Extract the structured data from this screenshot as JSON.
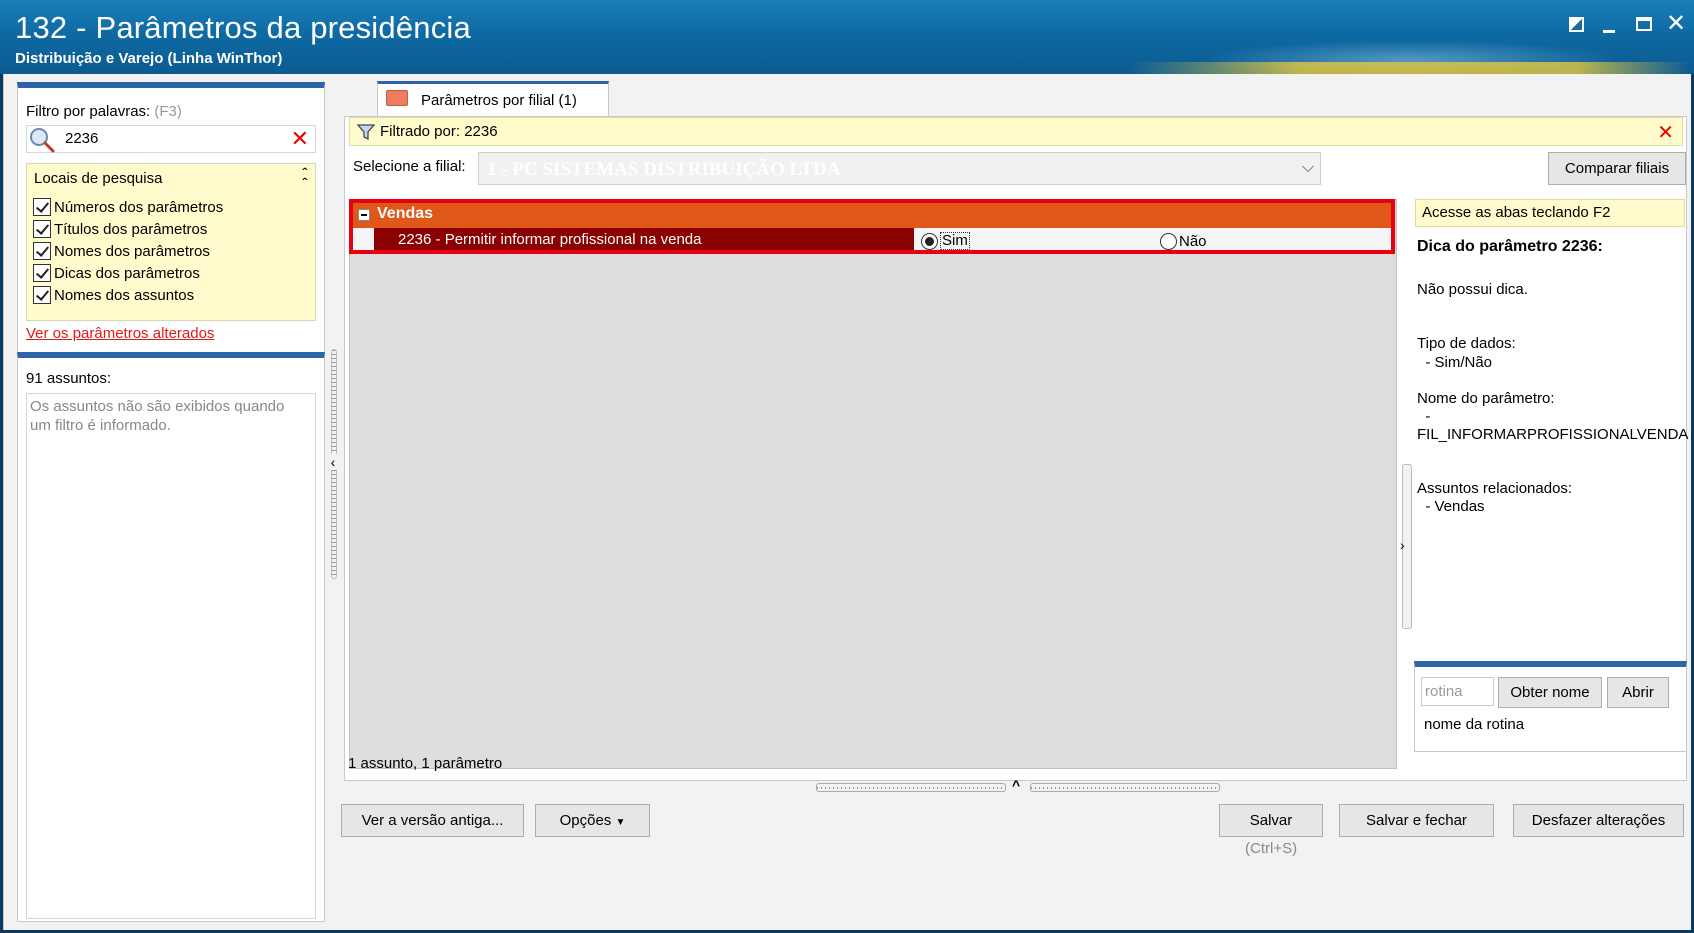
{
  "window": {
    "title": "132 - Parâmetros da presidência",
    "subtitle": "Distribuição e Varejo (Linha WinThor)"
  },
  "filter": {
    "label": "Filtro por palavras:",
    "shortcut": "(F3)",
    "value": "2236",
    "locais_title": "Locais de pesquisa",
    "checkboxes": [
      {
        "label": "Números dos parâmetros",
        "checked": true
      },
      {
        "label": "Títulos dos parâmetros",
        "checked": true
      },
      {
        "label": "Nomes dos parâmetros",
        "checked": true
      },
      {
        "label": "Dicas dos parâmetros",
        "checked": true
      },
      {
        "label": "Nomes dos assuntos",
        "checked": true
      }
    ],
    "link_alterados": "Ver os parâmetros alterados"
  },
  "assuntos": {
    "count_label": "91 assuntos:",
    "message": "Os assuntos não são exibidos quando um filtro é informado."
  },
  "tab": {
    "label": "Parâmetros por filial  (1)"
  },
  "filtrado": {
    "text": "Filtrado por: 2236"
  },
  "filial": {
    "label": "Selecione a filial:",
    "value": "1 - PC SISTEMAS DISTRIBUIÇÃO LTDA",
    "compare_button": "Comparar filiais"
  },
  "grid": {
    "group": "Vendas",
    "row": {
      "name": "2236 - Permitir informar profissional na venda",
      "option_yes": "Sim",
      "option_no": "Não",
      "selected": "Sim"
    }
  },
  "tips": {
    "access_hint": "Acesse as abas teclando F2",
    "title": "Dica do parâmetro 2236:",
    "no_tip": "Não possui dica.",
    "data_type_label": "Tipo de dados:",
    "data_type_value": "  - Sim/Não",
    "param_name_label": "Nome do parâmetro:",
    "param_name_dash": "  -",
    "param_name_value": "FIL_INFORMARPROFISSIONALVENDA",
    "related_label": "Assuntos relacionados:",
    "related_value": "  - Vendas"
  },
  "rotina": {
    "placeholder": "rotina",
    "get_name_button": "Obter nome",
    "open_button": "Abrir",
    "name_label": "nome da rotina"
  },
  "status": {
    "text": "1 assunto, 1 parâmetro"
  },
  "buttons": {
    "old_version": "Ver a versão antiga...",
    "options": "Opções",
    "save": "Salvar",
    "save_shortcut": "(Ctrl+S)",
    "save_close": "Salvar e fechar",
    "undo": "Desfazer alterações"
  },
  "colors": {
    "title_bar": "#0f6aa3",
    "group_header": "#e0571a",
    "selected_row": "#8b0000",
    "highlight_box": "#e60012",
    "hint_background": "#fffbcc",
    "link": "#e0191b"
  }
}
